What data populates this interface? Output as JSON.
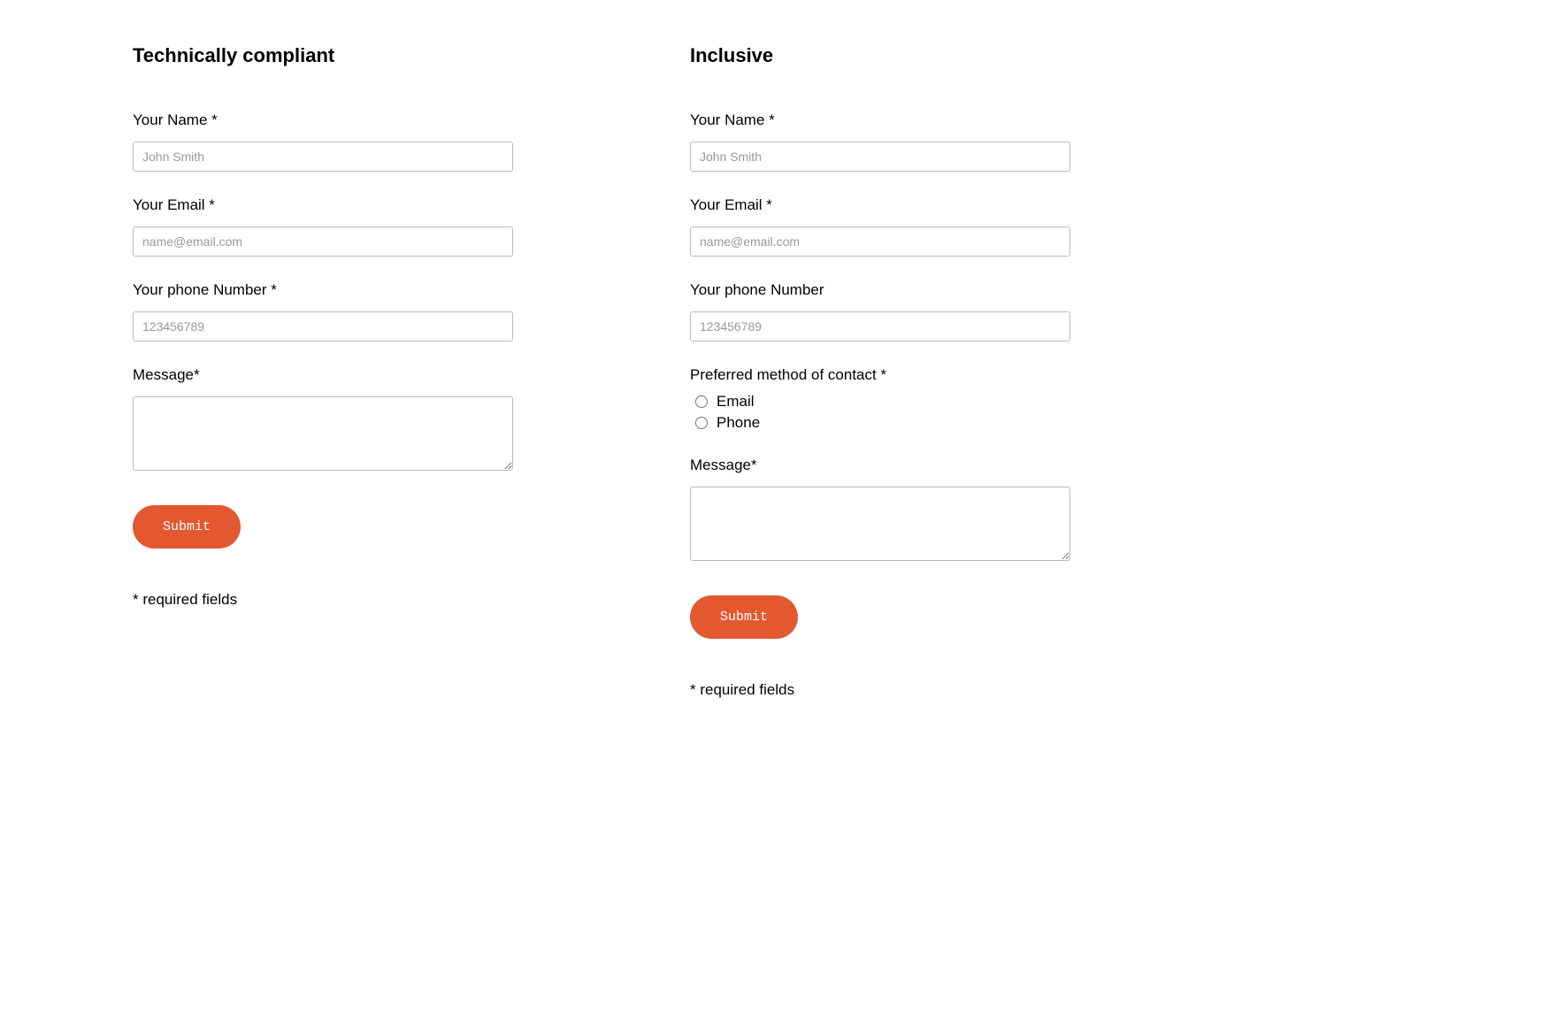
{
  "left": {
    "title": "Technically compliant",
    "name_label": "Your Name *",
    "name_placeholder": "John Smith",
    "email_label": "Your Email *",
    "email_placeholder": "name@email.com",
    "phone_label": "Your phone Number *",
    "phone_placeholder": "123456789",
    "message_label": "Message*",
    "submit_label": "Submit",
    "required_note": "* required fields"
  },
  "right": {
    "title": "Inclusive",
    "name_label": "Your Name *",
    "name_placeholder": "John Smith",
    "email_label": "Your Email *",
    "email_placeholder": "name@email.com",
    "phone_label": "Your phone Number",
    "phone_placeholder": "123456789",
    "contact_method_label": "Preferred method of contact *",
    "contact_option_email": "Email",
    "contact_option_phone": "Phone",
    "message_label": "Message*",
    "submit_label": "Submit",
    "required_note": "* required fields"
  }
}
